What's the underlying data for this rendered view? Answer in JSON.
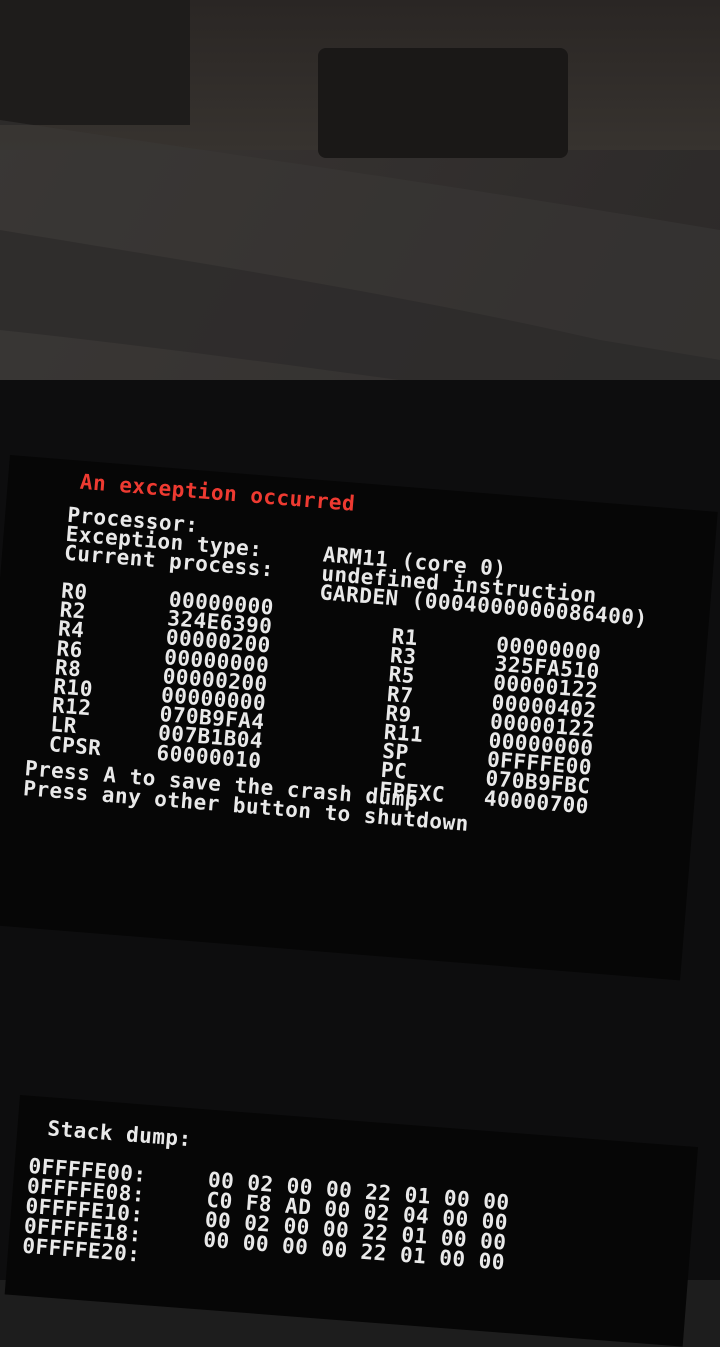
{
  "colors": {
    "background_text": "#e9e9e9",
    "accent": "#ee3a31",
    "screen": "#060606"
  },
  "crash_screen": {
    "title": "An exception occurred",
    "labels": [
      "Processor:",
      "Exception type:",
      "Current process:"
    ],
    "values": [
      "ARM11 (core 0)",
      "undefined instruction",
      "GARDEN (0004000000086400)"
    ],
    "registers_left": [
      {
        "name": "R0",
        "value": "00000000"
      },
      {
        "name": "R2",
        "value": "324E6390"
      },
      {
        "name": "R4",
        "value": "00000200"
      },
      {
        "name": "R6",
        "value": "00000000"
      },
      {
        "name": "R8",
        "value": "00000200"
      },
      {
        "name": "R10",
        "value": "00000000"
      },
      {
        "name": "R12",
        "value": "070B9FA4"
      },
      {
        "name": "LR",
        "value": "007B1B04"
      },
      {
        "name": "CPSR",
        "value": "60000010"
      }
    ],
    "registers_right": [
      {
        "name": "R1",
        "value": "00000000"
      },
      {
        "name": "R3",
        "value": "325FA510"
      },
      {
        "name": "R5",
        "value": "00000122"
      },
      {
        "name": "R7",
        "value": "00000402"
      },
      {
        "name": "R9",
        "value": "00000122"
      },
      {
        "name": "R11",
        "value": "00000000"
      },
      {
        "name": "SP",
        "value": "0FFFFE00"
      },
      {
        "name": "PC",
        "value": "070B9FBC"
      },
      {
        "name": "FPEXC",
        "value": "40000700"
      }
    ],
    "prompt_save": "Press A to save the crash dump",
    "prompt_shutdown": "Press any other button to shutdown"
  },
  "stack_dump": {
    "title": "Stack dump:",
    "rows": [
      {
        "address": "0FFFFE00:",
        "bytes": "00 02 00 00 22 01 00 00"
      },
      {
        "address": "0FFFFE08:",
        "bytes": "C0 F8 AD 00 02 04 00 00"
      },
      {
        "address": "0FFFFE10:",
        "bytes": "00 02 00 00 22 01 00 00"
      },
      {
        "address": "0FFFFE18:",
        "bytes": "00 00 00 00 22 01 00 00"
      },
      {
        "address": "0FFFFE20:",
        "bytes": ""
      }
    ]
  }
}
